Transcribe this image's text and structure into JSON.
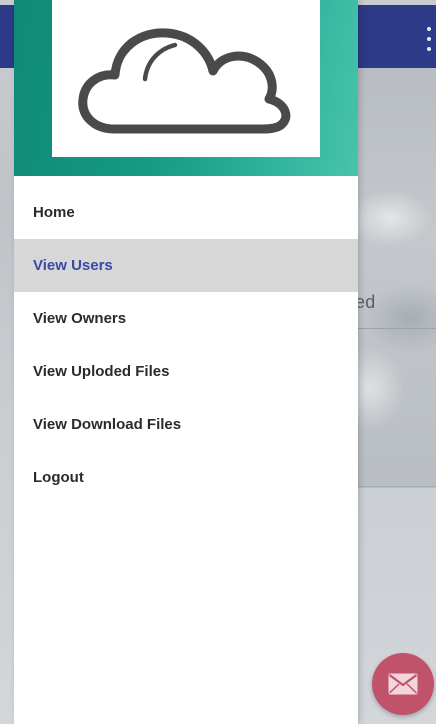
{
  "app": {
    "partial_text": "ed",
    "toolbar_color": "#2c3a87",
    "fab_color": "#c0526a",
    "fab_icon": "mail-icon",
    "overflow_icon": "more-vertical-icon"
  },
  "drawer": {
    "header_gradient": [
      "#0f8a76",
      "#48c3ac"
    ],
    "logo_icon": "cloud-icon",
    "active_color": "#3948a9",
    "items": [
      {
        "label": "Home",
        "active": false
      },
      {
        "label": "View Users",
        "active": true
      },
      {
        "label": "View Owners",
        "active": false
      },
      {
        "label": "View Uploded Files",
        "active": false
      },
      {
        "label": "View Download Files",
        "active": false
      },
      {
        "label": "Logout",
        "active": false
      }
    ]
  }
}
